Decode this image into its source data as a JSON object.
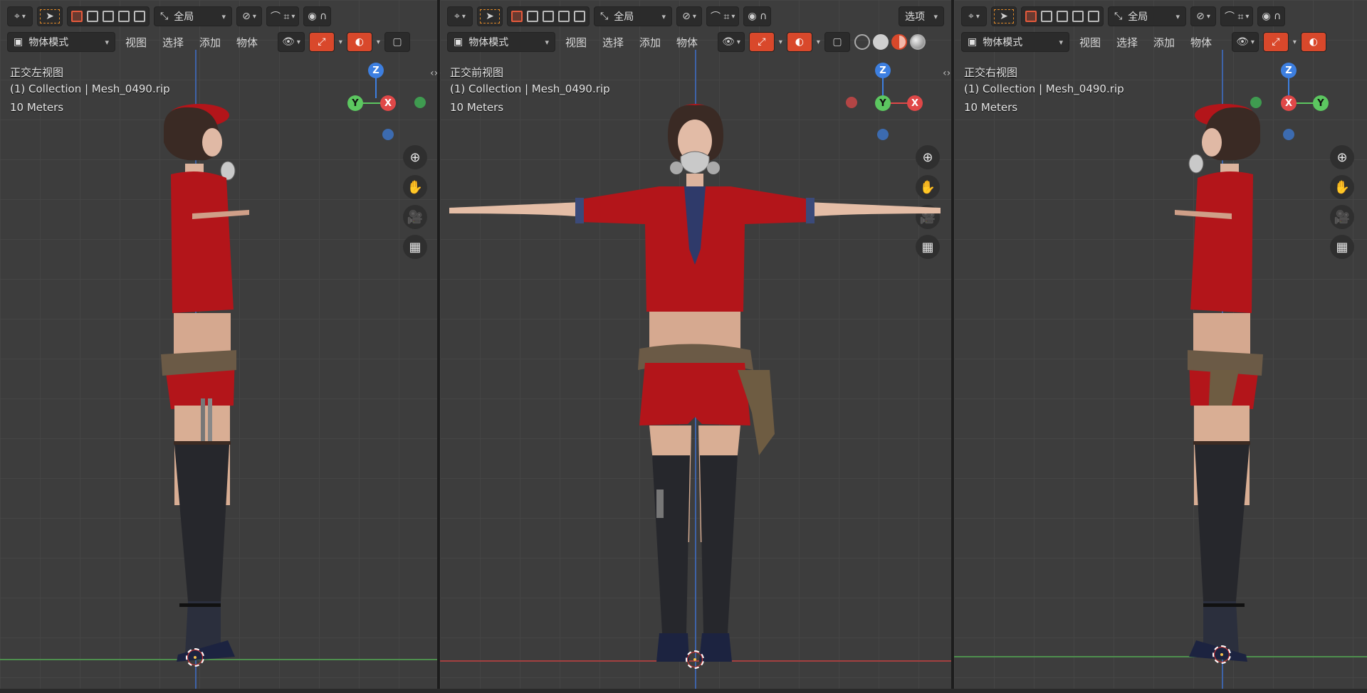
{
  "viewports": [
    {
      "id": "left",
      "view_name": "正交左视图",
      "collection_info": "(1) Collection | Mesh_0490.rip",
      "scale_label": "10 Meters",
      "mode_label": "物体模式",
      "menu": [
        "视图",
        "选择",
        "添加",
        "物体"
      ],
      "transform_orientation": "全局"
    },
    {
      "id": "front",
      "view_name": "正交前视图",
      "collection_info": "(1) Collection | Mesh_0490.rip",
      "scale_label": "10 Meters",
      "mode_label": "物体模式",
      "menu": [
        "视图",
        "选择",
        "添加",
        "物体"
      ],
      "transform_orientation": "全局",
      "options_label": "选项"
    },
    {
      "id": "right",
      "view_name": "正交右视图",
      "collection_info": "(1) Collection | Mesh_0490.rip",
      "scale_label": "10 Meters",
      "mode_label": "物体模式",
      "menu": [
        "视图",
        "选择",
        "添加",
        "物体"
      ],
      "transform_orientation": "全局"
    }
  ],
  "gizmo_labels": {
    "x": "X",
    "y": "Y",
    "z": "Z"
  },
  "colors": {
    "viewport_bg": "#3d3d3d",
    "grid": "#464646",
    "axis_x": "#e04848",
    "axis_y": "#5cc760",
    "axis_z": "#3d7fe0",
    "accent_active": "#d9482b",
    "outfit_red": "#b3151a"
  },
  "icons": [
    "zoom-icon",
    "pan-hand-icon",
    "camera-icon",
    "grid-toggle-icon"
  ]
}
